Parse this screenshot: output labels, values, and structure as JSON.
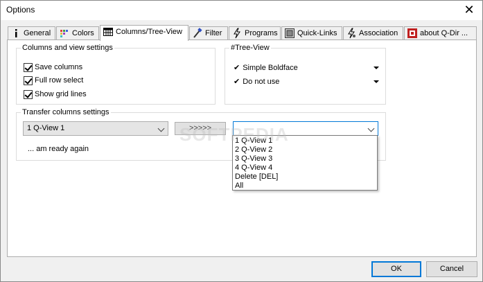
{
  "window": {
    "title": "Options",
    "close_glyph": "✕"
  },
  "tabs": [
    {
      "label": "General",
      "icon": "info-icon"
    },
    {
      "label": "Colors",
      "icon": "color-palette-icon"
    },
    {
      "label": "Columns/Tree-View",
      "icon": "columns-grid-icon",
      "active": true
    },
    {
      "label": "Filter",
      "icon": "brush-filter-icon"
    },
    {
      "label": "Programs",
      "icon": "programs-icon"
    },
    {
      "label": "Quick-Links",
      "icon": "quick-links-icon"
    },
    {
      "label": "Association",
      "icon": "association-icon"
    },
    {
      "label": "about Q-Dir ...",
      "icon": "about-icon"
    }
  ],
  "columns_group": {
    "title": "Columns and view settings",
    "save_columns": "Save columns",
    "full_row_select": "Full row select",
    "show_grid_lines": "Show grid lines"
  },
  "treeview_group": {
    "title": "#Tree-View",
    "check_glyph": "✔",
    "row1": "Simple Boldface",
    "row2": "Do not use"
  },
  "transfer_group": {
    "title": "Transfer columns settings",
    "source_value": "1 Q-View 1",
    "arrow_button": ">>>>>",
    "target_value": "",
    "status": "... am ready again",
    "dropdown_options": [
      "1 Q-View 1",
      "2 Q-View 2",
      "3 Q-View 3",
      "4 Q-View 4",
      "Delete [DEL]",
      "All"
    ]
  },
  "watermark": "SOFTPEDIA",
  "footer": {
    "ok": "OK",
    "cancel": "Cancel"
  },
  "colors": {
    "accent": "#0078d7",
    "panel_bg": "#ffffff",
    "window_bg": "#f0f0f0"
  }
}
